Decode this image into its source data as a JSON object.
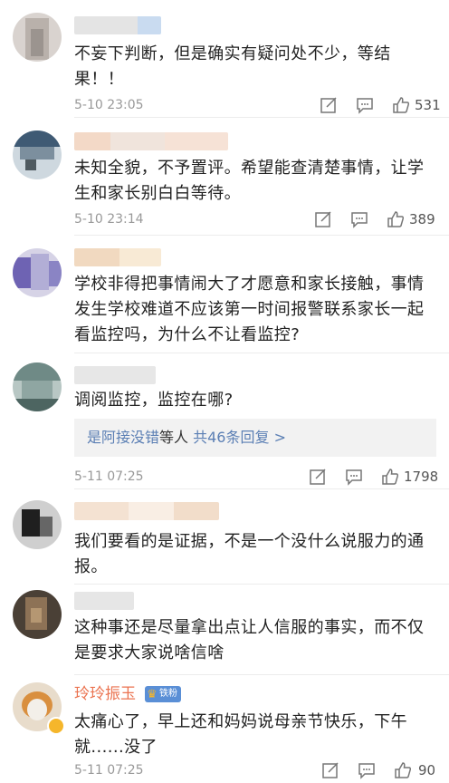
{
  "comments": [
    {
      "text": "不妄下判断，但是确实有疑问处不少，等结果！！",
      "time": "5-10 23:05",
      "likes": "531"
    },
    {
      "text": "未知全貌，不予置评。希望能查清楚事情，让学生和家长别白白等待。",
      "time": "5-10 23:14",
      "likes": "389"
    },
    {
      "text": "学校非得把事情闹大了才愿意和家长接触，事情发生学校难道不应该第一时间报警联系家长一起看监控吗，为什么不让看监控?",
      "time": "",
      "likes": ""
    },
    {
      "text": "调阅监控，监控在哪?",
      "reply_link": "是阿接没错",
      "reply_rest": "等人",
      "reply_count": "共46条回复 >",
      "time": "5-11 07:25",
      "likes": "1798"
    },
    {
      "text": "我们要看的是证据，不是一个没什么说服力的通报。",
      "time": "",
      "likes": ""
    },
    {
      "text": "这种事还是尽量拿出点让人信服的事实，而不仅是要求大家说啥信啥",
      "time": "",
      "likes": ""
    },
    {
      "username": "玲玲振玉",
      "badge": "铁粉",
      "text": "太痛心了，早上还和妈妈说母亲节快乐，下午就......没了",
      "time": "5-11 07:25",
      "likes": "90"
    }
  ],
  "colors": {
    "username_accent": "#eb7350",
    "reply_link": "#5b7fb4",
    "badge_bg": "#5a8fd6"
  },
  "icons": [
    "share-icon",
    "comment-icon",
    "like-icon"
  ]
}
